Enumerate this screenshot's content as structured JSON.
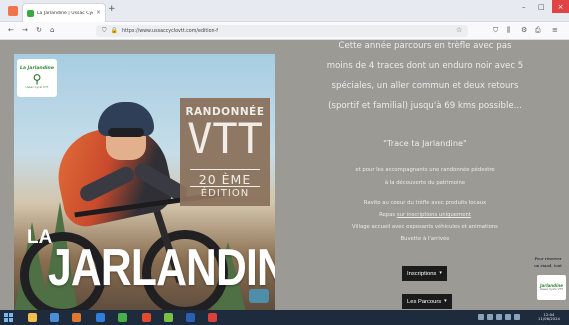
{
  "browser": {
    "tab_title": "La Jarlandine | Ussac Cyclo VE",
    "tab_close": "×",
    "new_tab": "+",
    "url": "https://www.ussaccyclovtt.com/edition-f",
    "window_controls": {
      "minimize": "–",
      "maximize": "□",
      "close": "×"
    },
    "nav_icons": {
      "back": "←",
      "forward": "→",
      "reload": "↻",
      "home": "⌂"
    },
    "url_icons": {
      "shield": "⛉",
      "lock": "🔒"
    },
    "toolbar_icons": {
      "bookmark": "☆",
      "pocket": "⛉",
      "library": "⫼",
      "extensions": "⚙",
      "account": "⎙",
      "menu": "≡"
    }
  },
  "poster": {
    "logo_text": "La Jarlandine",
    "logo_glyph": "⚲",
    "logo_sub": "Ussac Cyclo VTT",
    "randonnee": "RANDONNÉE",
    "vtt": "VTT",
    "edition_number": "20 ÈME",
    "edition_word": "ÉDITION",
    "la": "LA",
    "jarlandine": "JARLANDINE"
  },
  "content": {
    "intro_lines": [
      "Cette année parcours en trèfle avec pas",
      "moins de 4 traces dont un enduro noir avec 5",
      "spéciales, un aller commun et deux retours",
      "(sportif et familial) jusqu'à 69 kms possible..."
    ],
    "slogan": "\"Trace ta Jarlandine\"",
    "walk_lines": [
      "et pour les accompagnants une randonnée pédestre",
      "à la découverte du patrimoine"
    ],
    "info_line1": "Ravito au coeur du trèfle avec produits locaux",
    "info_line2_prefix": "Repas ",
    "info_line2_link": "sur inscriptions uniquement",
    "info_line3": "Village accueil avec exposants véhicules et animations",
    "info_line4": "Buvette à l'arrivée",
    "inscriptions_label": "Inscriptions",
    "parcours_label": "Les Parcours",
    "caret": "▾"
  },
  "sidebar": {
    "note_line1": "Pour réserver",
    "note_line2": "un stand, tout",
    "logo_text": "Jarlandine",
    "logo_sub": "Ussac Cyclo VTT"
  },
  "taskbar": {
    "time": "12:04",
    "date": "11/06/2024",
    "icon_colors": [
      "#f0c04a",
      "#4a8fd6",
      "#e07832",
      "#2f7ed8",
      "#46b04a",
      "#e34c2b",
      "#7ac143",
      "#2b5fb4",
      "#d9403a"
    ]
  }
}
